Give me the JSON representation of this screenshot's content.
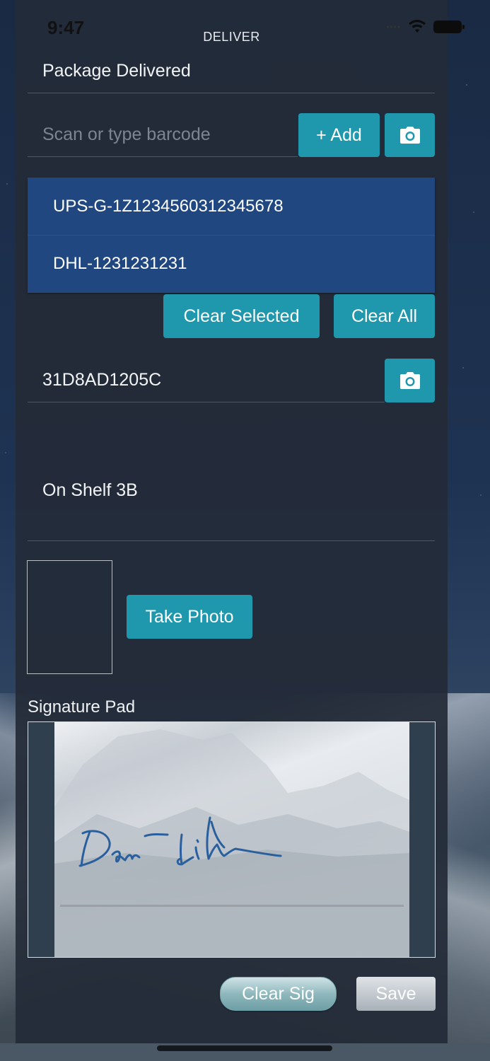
{
  "status_bar": {
    "time": "9:47"
  },
  "header": {
    "title": "DELIVER"
  },
  "status": {
    "value": "Package Delivered"
  },
  "barcode": {
    "placeholder": "Scan or type barcode",
    "add_label": "+ Add",
    "camera_icon": "camera-icon"
  },
  "barcode_list": {
    "items": [
      "UPS-G-1Z1234560312345678",
      "DHL-1231231231"
    ],
    "clear_selected_label": "Clear Selected",
    "clear_all_label": "Clear All"
  },
  "locker": {
    "value": "31D8AD1205C",
    "camera_icon": "camera-icon"
  },
  "location": {
    "value": "On Shelf 3B"
  },
  "photo": {
    "take_photo_label": "Take Photo"
  },
  "signature": {
    "label": "Signature Pad",
    "clear_label": "Clear Sig",
    "save_label": "Save"
  },
  "colors": {
    "accent": "#1f97ad",
    "list_background": "#214781",
    "panel": "#232b38",
    "signature_ink": "#2a5f9e"
  }
}
